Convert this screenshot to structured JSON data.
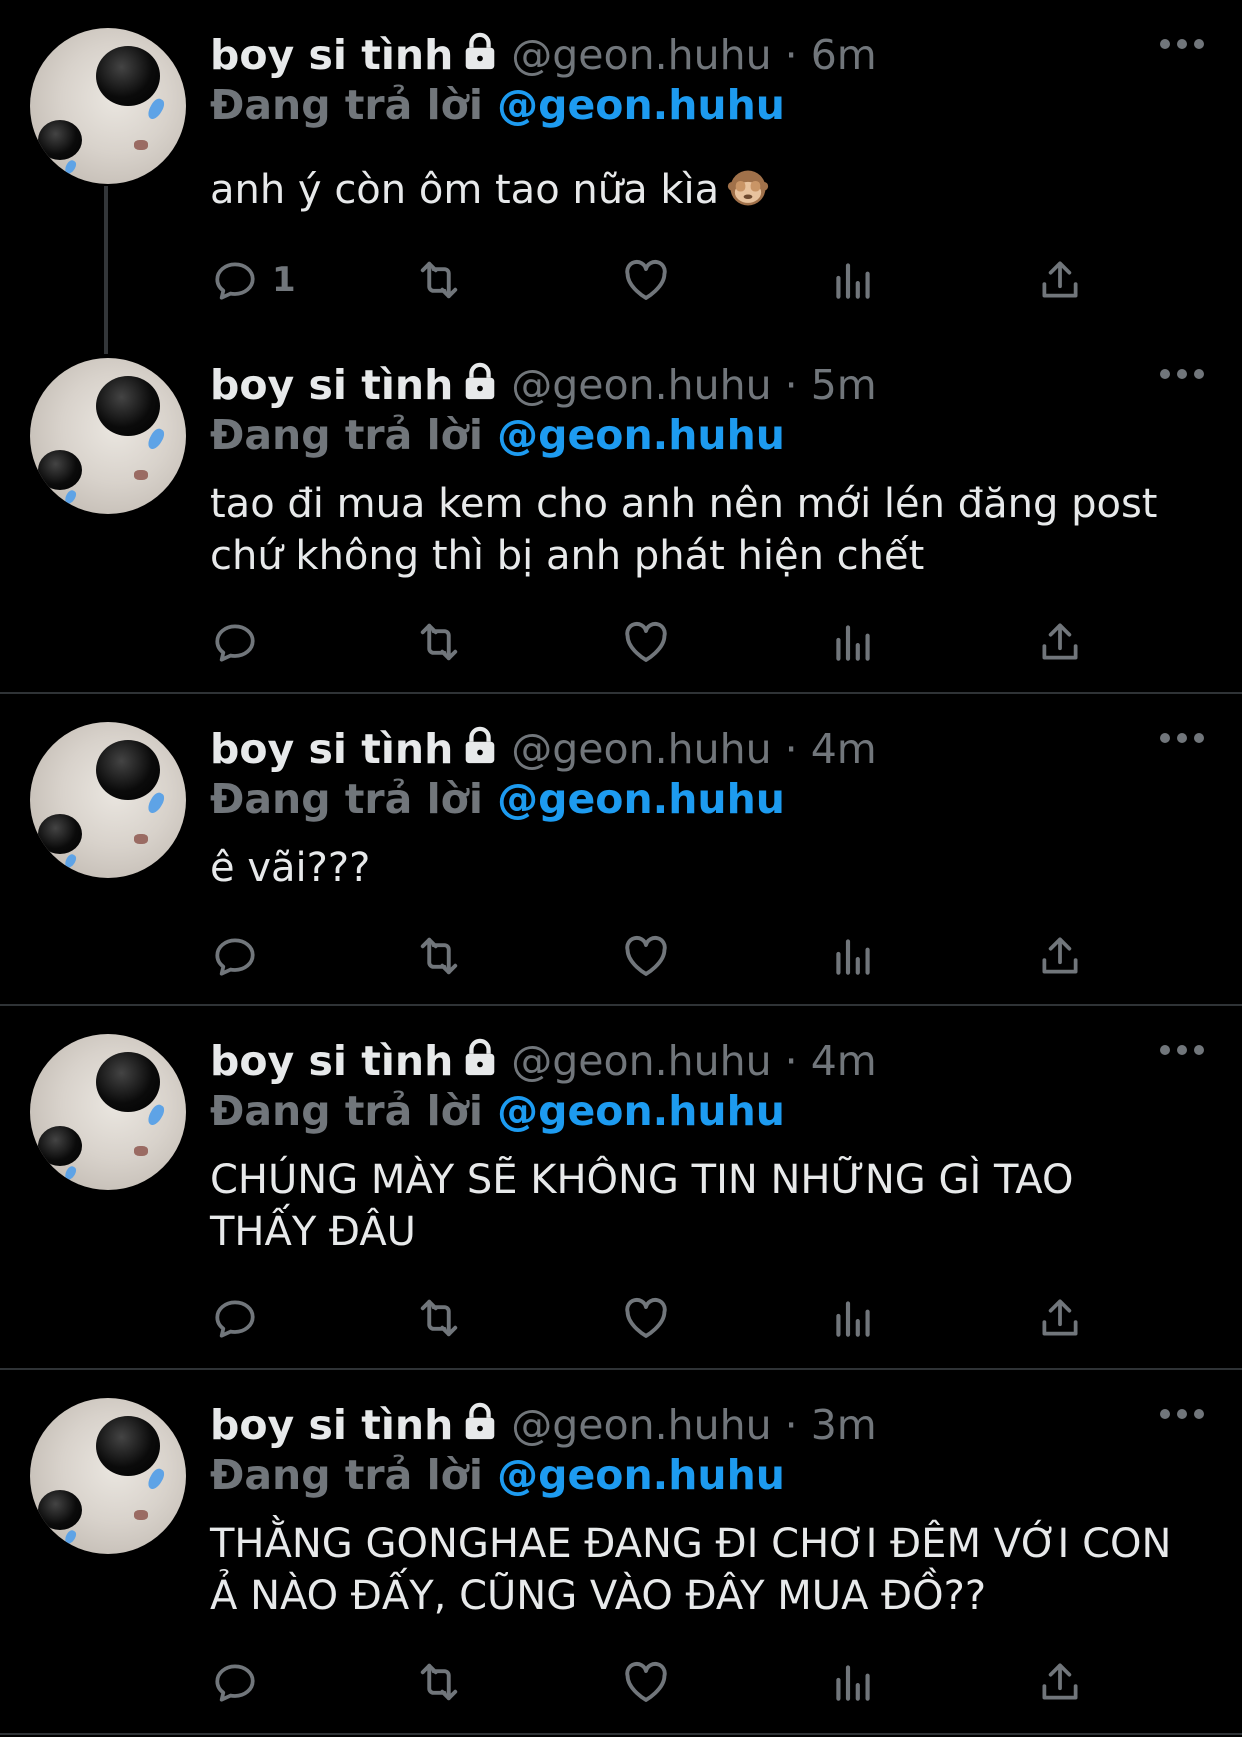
{
  "colors": {
    "background": "#000000",
    "text": "#e7e9ea",
    "muted": "#71767b",
    "accent": "#1d9bf0",
    "divider": "#2f3336"
  },
  "tweets": [
    {
      "name": "boy si tình",
      "handle": "@geon.huhu",
      "separator": "·",
      "time": "6m",
      "reply_label": "Đang trả lời",
      "reply_to": "@geon.huhu",
      "text": "anh ý còn ôm tao nữa kìa",
      "emoji": "see-no-evil-monkey-icon",
      "reply_count": "1"
    },
    {
      "name": "boy si tình",
      "handle": "@geon.huhu",
      "separator": "·",
      "time": "5m",
      "reply_label": "Đang trả lời",
      "reply_to": "@geon.huhu",
      "text_line1": "tao đi mua kem cho anh nên mới lén đăng post",
      "text_line2": "chứ không thì bị anh phát hiện chết"
    },
    {
      "name": "boy si tình",
      "handle": "@geon.huhu",
      "separator": "·",
      "time": "4m",
      "reply_label": "Đang trả lời",
      "reply_to": "@geon.huhu",
      "text": "ê vãi???"
    },
    {
      "name": "boy si tình",
      "handle": "@geon.huhu",
      "separator": "·",
      "time": "4m",
      "reply_label": "Đang trả lời",
      "reply_to": "@geon.huhu",
      "text_line1": "CHÚNG MÀY SẼ KHÔNG TIN NHỮNG GÌ TAO",
      "text_line2": "THẤY ĐÂU"
    },
    {
      "name": "boy si tình",
      "handle": "@geon.huhu",
      "separator": "·",
      "time": "3m",
      "reply_label": "Đang trả lời",
      "reply_to": "@geon.huhu",
      "text_line1": "THẰNG GONGHAE ĐANG ĐI CHƠI ĐÊM VỚI CON",
      "text_line2": "Ả NÀO ĐẤY, CŨNG VÀO ĐÂY MUA ĐỒ??"
    }
  ],
  "icons": [
    "reply-icon",
    "retweet-icon",
    "like-icon",
    "analytics-icon",
    "share-icon",
    "lock-icon",
    "more-icon"
  ]
}
